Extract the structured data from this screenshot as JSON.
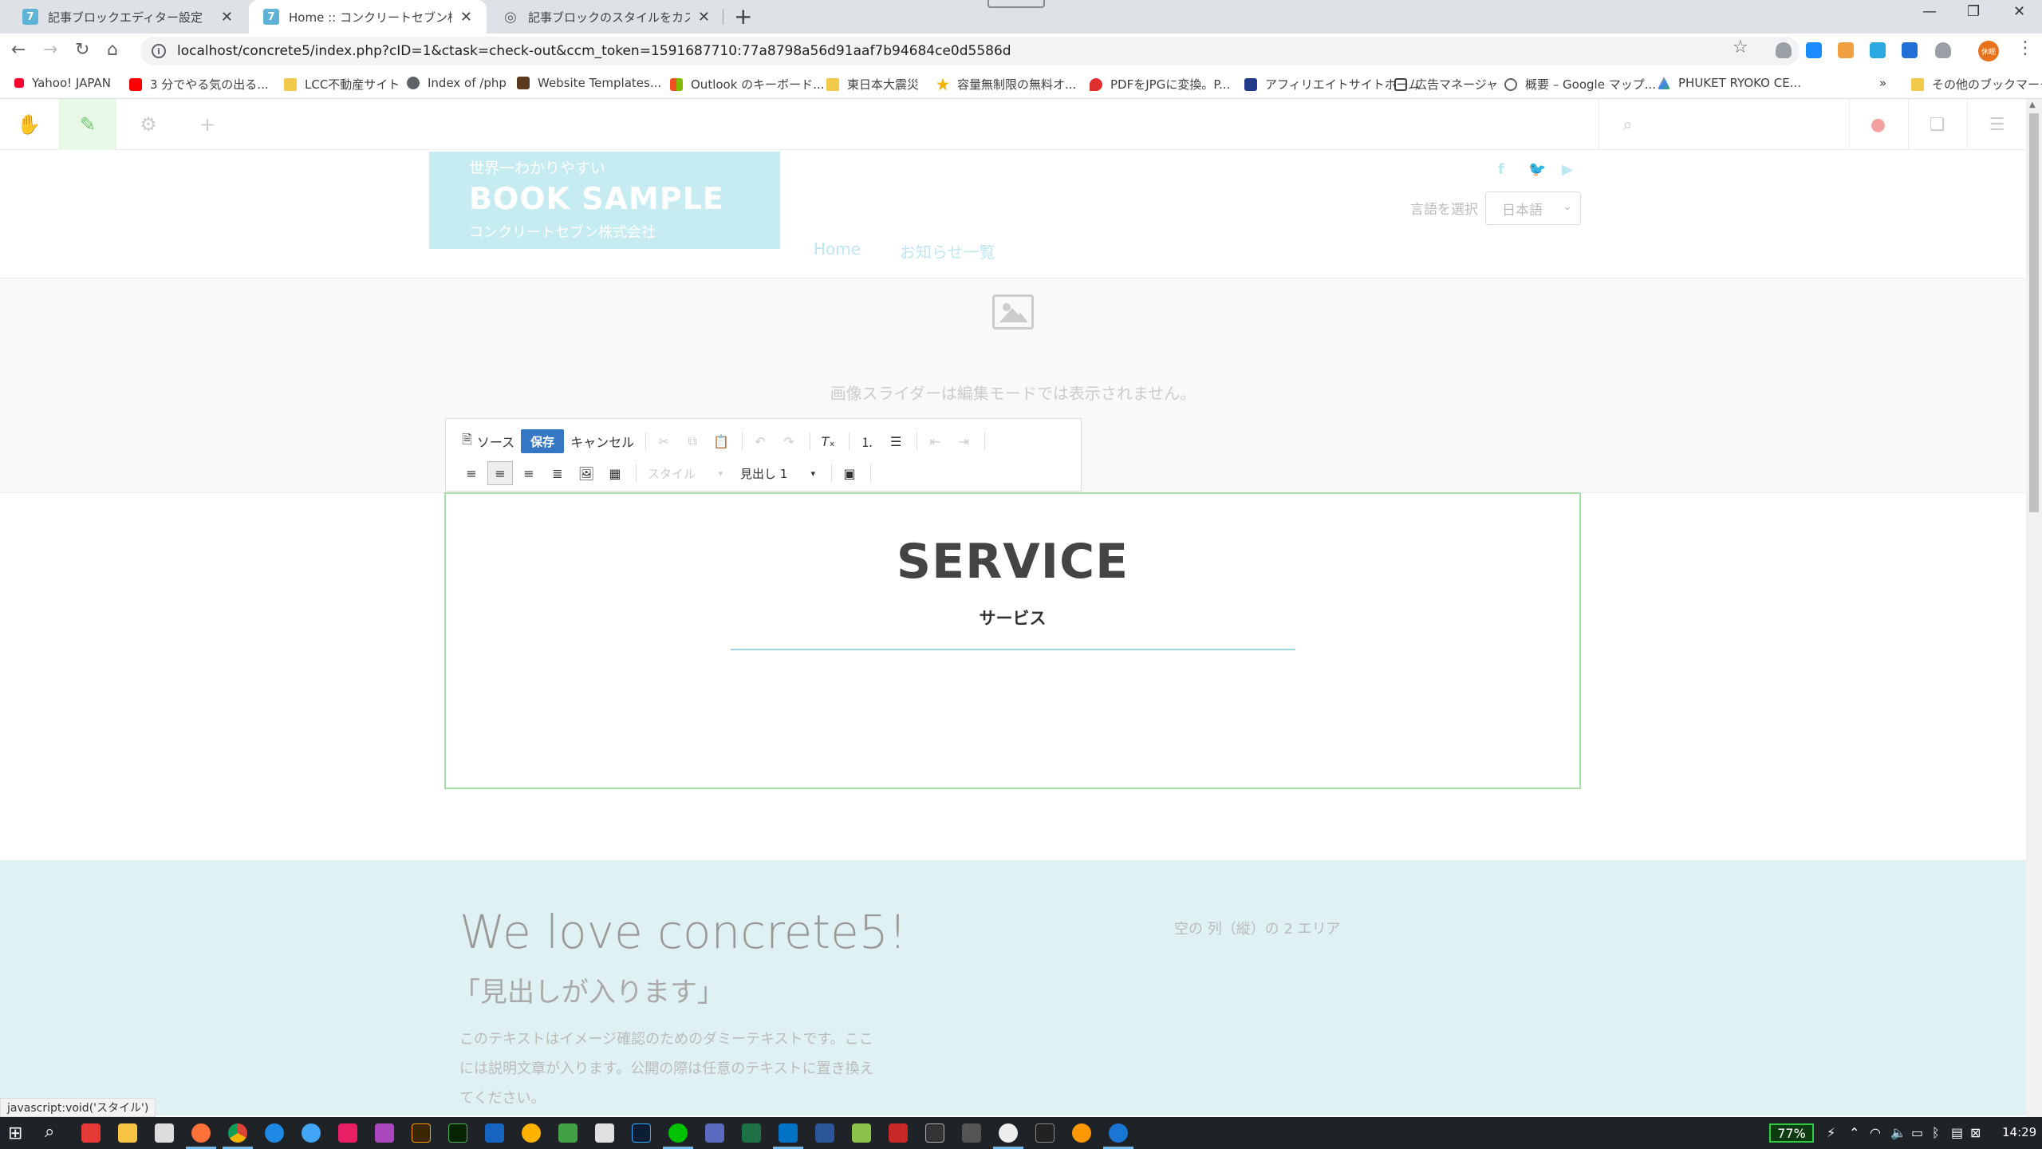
{
  "browser": {
    "tabs": [
      {
        "title": "記事ブロックエディター設定",
        "icon": "7"
      },
      {
        "title": "Home :: コンクリートセブン株式会社",
        "icon": "7"
      },
      {
        "title": "記事ブロックのスタイルをカスタマイズ..",
        "icon": "globe"
      }
    ],
    "url": "localhost/concrete5/index.php?cID=1&ctask=check-out&ccm_token=1591687710:77a8798a56d91aaf7b94684ce0d5586d",
    "avatar_text": "休眠",
    "bookmarks": [
      "Yahoo! JAPAN",
      "3 分でやる気の出る...",
      "LCC不動産サイト",
      "Index of /php",
      "Website Templates...",
      "Outlook のキーボード...",
      "東日本大震災",
      "容量無制限の無料オ...",
      "PDFをJPGに変換。P...",
      "アフィリエイトサイトホーム",
      "広告マネージャ",
      "概要 – Google マップ...",
      "PHUKET RYOKO CE...",
      "その他のブックマーク"
    ],
    "status_text": "javascript:void('スタイル')"
  },
  "site": {
    "logo_line1": "世界一わかりやすい",
    "logo_line2": "BOOK SAMPLE",
    "logo_line3": "コンクリートセブン株式会社",
    "lang_label": "言語を選択",
    "lang_value": "日本語",
    "nav": [
      "Home",
      "お知らせ一覧"
    ],
    "slider_message": "画像スライダーは編集モードでは表示されません。"
  },
  "editor_toolbar": {
    "source": "ソース",
    "save": "保存",
    "cancel": "キャンセル",
    "style_combo": "スタイル",
    "format_combo": "見出し 1"
  },
  "editor_content": {
    "title": "SERVICE",
    "subtitle": "サービス"
  },
  "bottom": {
    "heading": "We love concrete5!",
    "subheading": "「見出しが入ります」",
    "text": "このテキストはイメージ確認のためのダミーテキストです。ここには説明文章が入ります。公開の際は任意のテキストに置き換えてください。",
    "empty_area": "空の 列（縦）の 2 エリア"
  },
  "taskbar": {
    "battery": "77%",
    "time": "14:29"
  },
  "colors": {
    "logo_bg": "#c6ecf2",
    "save_button": "#3577c2",
    "editor_border": "#a6dfa6",
    "bottom_bg": "#e0f1f4"
  }
}
